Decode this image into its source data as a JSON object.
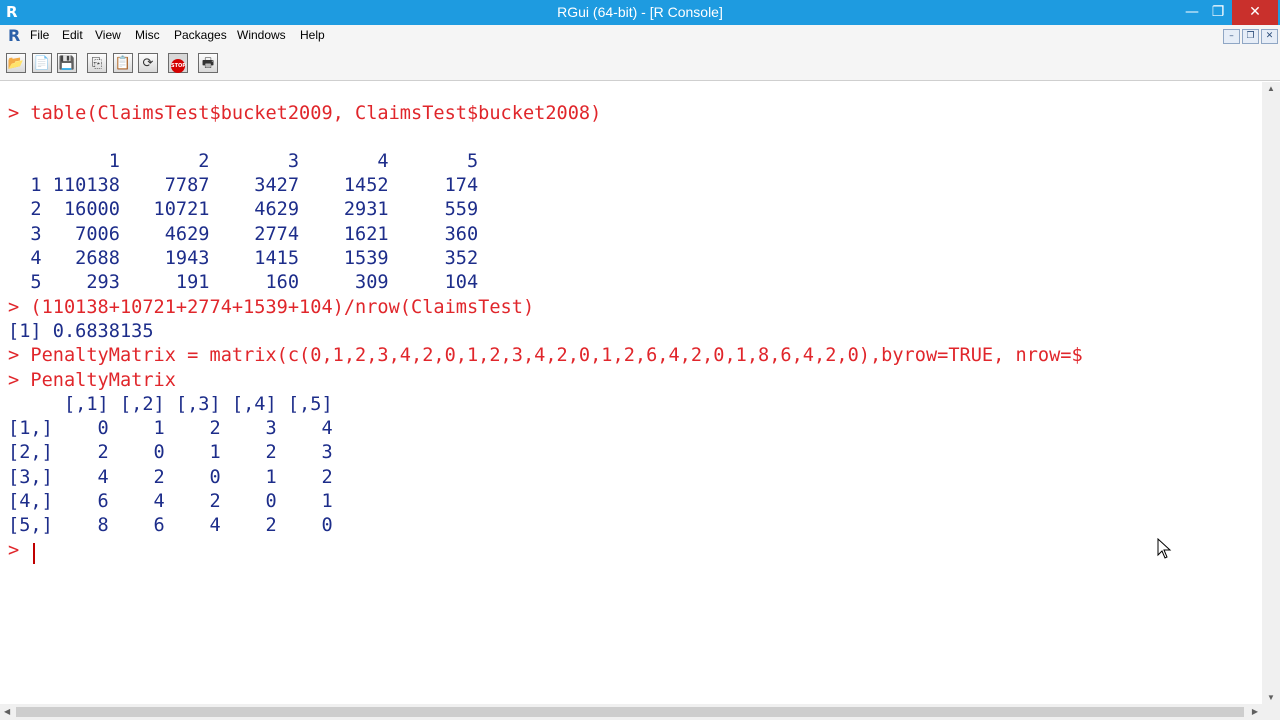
{
  "window": {
    "title": "RGui (64-bit) - [R Console]",
    "controls": {
      "minimize": "—",
      "maximize": "❐",
      "close": "✕"
    }
  },
  "menubar": {
    "items": [
      "File",
      "Edit",
      "View",
      "Misc",
      "Packages",
      "Windows",
      "Help"
    ],
    "mdi_controls": {
      "minimize": "–",
      "restore": "❐",
      "close": "✕"
    }
  },
  "toolbar": {
    "buttons": [
      {
        "name": "open-script-icon",
        "glyph": "📂"
      },
      {
        "name": "load-workspace-icon",
        "glyph": "📄"
      },
      {
        "name": "save-workspace-icon",
        "glyph": "💾"
      },
      {
        "name": "copy-icon",
        "glyph": "⎘"
      },
      {
        "name": "paste-icon",
        "glyph": "📋"
      },
      {
        "name": "copy-paste-icon",
        "glyph": "⟳"
      },
      {
        "name": "stop-icon",
        "glyph": "STOP"
      },
      {
        "name": "print-icon",
        "glyph": "🖶"
      }
    ]
  },
  "console": {
    "lines": [
      {
        "type": "cmd",
        "text": "> table(ClaimsTest$bucket2009, ClaimsTest$bucket2008)"
      },
      {
        "type": "out",
        "text": ""
      },
      {
        "type": "out",
        "text": "         1       2       3       4       5"
      },
      {
        "type": "out",
        "text": "  1 110138    7787    3427    1452     174"
      },
      {
        "type": "out",
        "text": "  2  16000   10721    4629    2931     559"
      },
      {
        "type": "out",
        "text": "  3   7006    4629    2774    1621     360"
      },
      {
        "type": "out",
        "text": "  4   2688    1943    1415    1539     352"
      },
      {
        "type": "out",
        "text": "  5    293     191     160     309     104"
      },
      {
        "type": "cmd",
        "text": "> (110138+10721+2774+1539+104)/nrow(ClaimsTest)"
      },
      {
        "type": "out",
        "text": "[1] 0.6838135"
      },
      {
        "type": "cmd",
        "text": "> PenaltyMatrix = matrix(c(0,1,2,3,4,2,0,1,2,3,4,2,0,1,2,6,4,2,0,1,8,6,4,2,0),byrow=TRUE, nrow=$"
      },
      {
        "type": "cmd",
        "text": "> PenaltyMatrix"
      },
      {
        "type": "out",
        "text": "     [,1] [,2] [,3] [,4] [,5]"
      },
      {
        "type": "out",
        "text": "[1,]    0    1    2    3    4"
      },
      {
        "type": "out",
        "text": "[2,]    2    0    1    2    3"
      },
      {
        "type": "out",
        "text": "[3,]    4    2    0    1    2"
      },
      {
        "type": "out",
        "text": "[4,]    6    4    2    0    1"
      },
      {
        "type": "out",
        "text": "[5,]    8    6    4    2    0"
      },
      {
        "type": "cmd",
        "text": "> "
      }
    ]
  }
}
